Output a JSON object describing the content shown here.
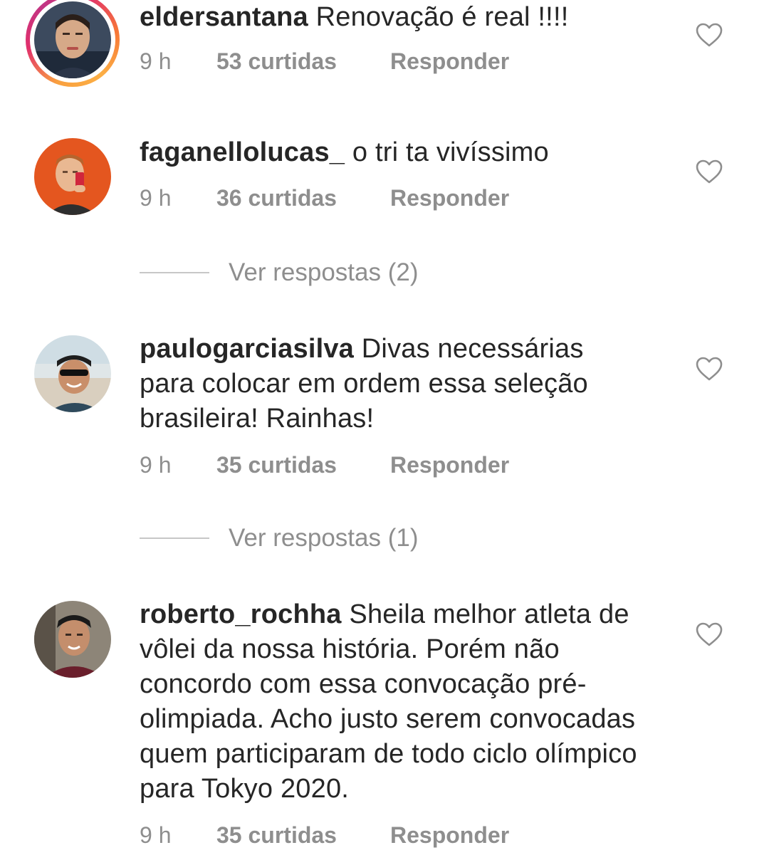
{
  "comments": [
    {
      "username": "eldersantana",
      "text": "Renovação é real !!!!",
      "time": "9 h",
      "likes": "53 curtidas",
      "reply_label": "Responder"
    },
    {
      "username": "faganellolucas_",
      "text": "o tri ta vivíssimo",
      "time": "9 h",
      "likes": "36 curtidas",
      "reply_label": "Responder",
      "view_replies": "Ver respostas (2)"
    },
    {
      "username": "paulogarciasilva",
      "text": "Divas necessárias para colocar em ordem essa seleção brasileira! Rainhas!",
      "time": "9 h",
      "likes": "35 curtidas",
      "reply_label": "Responder",
      "view_replies": "Ver respostas (1)"
    },
    {
      "username": "roberto_rochha",
      "text": "Sheila melhor atleta de vôlei da nossa história. Porém não concordo com essa convocação pré-olimpiada. Acho justo serem convocadas quem participaram de todo ciclo olímpico para Tokyo 2020.",
      "time": "9 h",
      "likes": "35 curtidas",
      "reply_label": "Responder"
    }
  ],
  "icons": {
    "like": "heart-outline-icon",
    "avatar": "user-avatar"
  },
  "colors": {
    "text": "#262626",
    "secondary": "#8e8e8e",
    "divider": "#c7c7c7",
    "story_ring": "#e1306c"
  }
}
